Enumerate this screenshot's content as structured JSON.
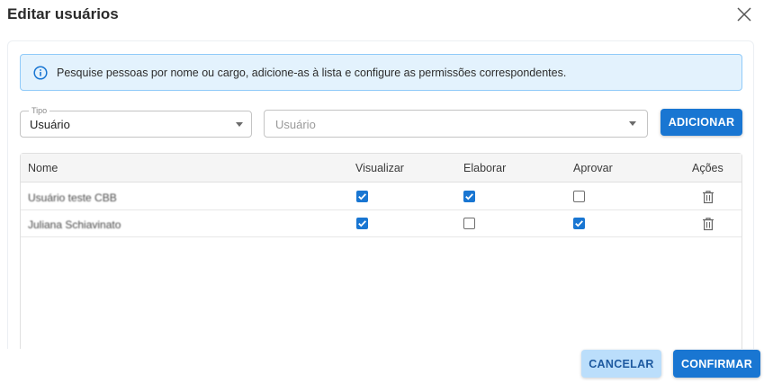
{
  "dialog": {
    "title": "Editar usuários",
    "close_icon": "close-icon"
  },
  "info": {
    "icon": "info-icon",
    "text": "Pesquise pessoas por nome ou cargo, adicione-as à lista e configure as permissões correspondentes."
  },
  "type_field": {
    "legend": "Tipo",
    "value": "Usuário"
  },
  "user_field": {
    "placeholder": "Usuário"
  },
  "add_button": "ADICIONAR",
  "table": {
    "headers": {
      "name": "Nome",
      "view": "Visualizar",
      "elaborate": "Elaborar",
      "approve": "Aprovar",
      "actions": "Ações"
    },
    "rows": [
      {
        "name": "Usuário teste CBB",
        "view": true,
        "elaborate": true,
        "approve": false,
        "action_icon": "trash-icon"
      },
      {
        "name": "Juliana Schiavinato",
        "view": true,
        "elaborate": false,
        "approve": true,
        "action_icon": "trash-icon"
      }
    ]
  },
  "footer": {
    "cancel": "CANCELAR",
    "confirm": "CONFIRMAR"
  },
  "colors": {
    "primary": "#1976d2",
    "info_bg": "#e3f2fd",
    "info_border": "#90caf9",
    "cancel_bg": "#bbdefb"
  }
}
